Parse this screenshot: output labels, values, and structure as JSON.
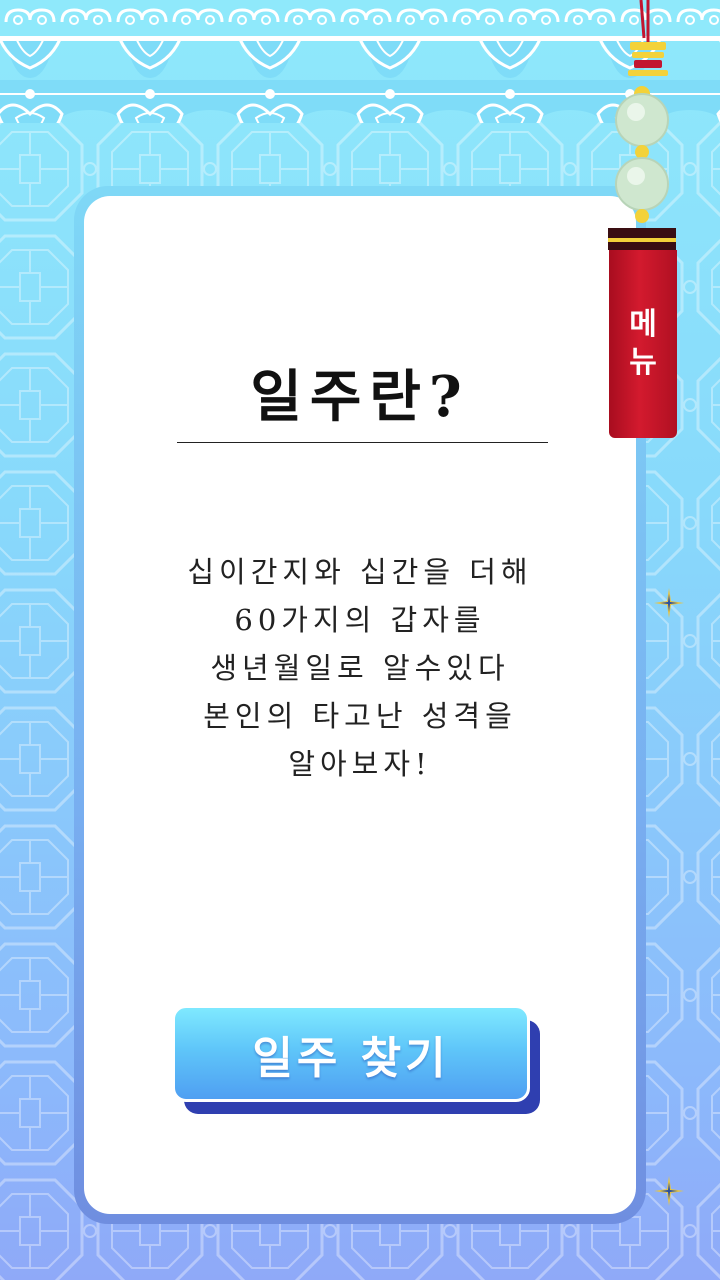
{
  "title": "일주란?",
  "description_lines": [
    "십이간지와 십간을 더해",
    "60가지의 갑자를",
    "생년월일로 알수있다",
    "본인의 타고난 성격을",
    "알아보자!"
  ],
  "find_button_label": "일주 찾기",
  "menu": {
    "line1": "메",
    "line2": "뉴"
  },
  "colors": {
    "bg_top": "#8fe9fb",
    "bg_bottom": "#8fa9f8",
    "button": "#5fc6f9",
    "menu_tag": "#d31a2e"
  }
}
